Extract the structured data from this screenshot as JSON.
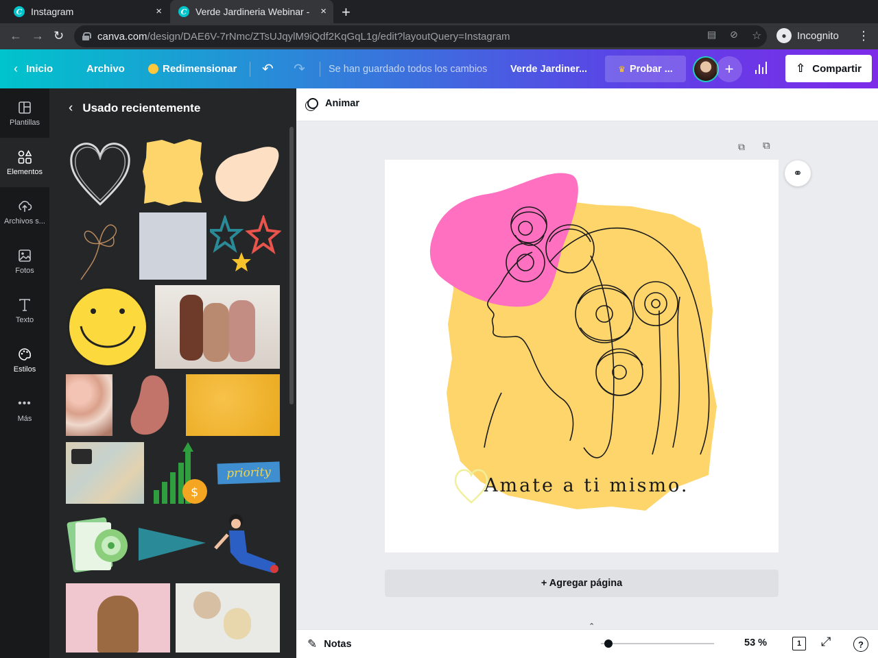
{
  "browser": {
    "tabs": [
      {
        "title": "Instagram",
        "close": "×"
      },
      {
        "title": "Verde Jardineria Webinar -",
        "close": "×"
      }
    ],
    "new_tab": "+",
    "url_host": "canva.com",
    "url_path": "/design/DAE6V-7rNmc/ZTsUJqylM9iQdf2KqGqL1g/edit?layoutQuery=Instagram",
    "profile": "Incognito",
    "favicon_letter": "C"
  },
  "header": {
    "home": "Inicio",
    "file": "Archivo",
    "resize": "Redimensionar",
    "saved_status": "Se han guardado todos los cambios",
    "design_title": "Verde Jardiner...",
    "try_pro": "Probar ...",
    "share": "Compartir"
  },
  "rail": [
    {
      "label": "Plantillas",
      "icon": "templates-icon"
    },
    {
      "label": "Elementos",
      "icon": "elements-icon"
    },
    {
      "label": "Archivos s...",
      "icon": "uploads-icon"
    },
    {
      "label": "Fotos",
      "icon": "photos-icon"
    },
    {
      "label": "Texto",
      "icon": "text-icon"
    },
    {
      "label": "Estilos",
      "icon": "styles-icon"
    },
    {
      "label": "Más",
      "icon": "more-icon"
    }
  ],
  "panel": {
    "title": "Usado recientemente",
    "accent_colors": {
      "yellow": "#fdd56b",
      "peach": "#fde0c4",
      "pink": "#ff70c0",
      "gray": "#cfd4dc",
      "rose": "#c2736a",
      "teal": "#2b8a98"
    }
  },
  "toolbar": {
    "animate": "Animar"
  },
  "design": {
    "caption": "Amate a ti mismo."
  },
  "add_page": "+ Agregar página",
  "bottom": {
    "notes": "Notas",
    "zoom": "53 %",
    "zoom_level": 0.53,
    "pages": "1",
    "help": "?"
  }
}
